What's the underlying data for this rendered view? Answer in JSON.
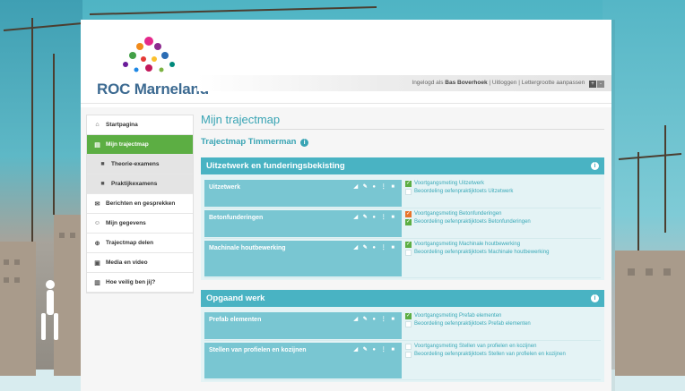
{
  "header": {
    "logo_text": "ROC Marneland",
    "userbar_prefix": "Ingelogd als",
    "user_name": "Bas Boverhoek",
    "logout_label": "Uitloggen",
    "font_size_label": "Lettergrootte aanpassen",
    "separator": "|"
  },
  "sidebar": {
    "items": [
      {
        "label": "Startpagina",
        "icon": "home-icon",
        "glyph": "⌂"
      },
      {
        "label": "Mijn trajectmap",
        "icon": "folder-icon",
        "glyph": "▤"
      },
      {
        "label": "Theorie-examens",
        "icon": "book-icon",
        "glyph": "■"
      },
      {
        "label": "Praktijkexamens",
        "icon": "book-icon",
        "glyph": "■"
      },
      {
        "label": "Berichten en gesprekken",
        "icon": "chat-icon",
        "glyph": "✉"
      },
      {
        "label": "Mijn gegevens",
        "icon": "user-icon",
        "glyph": "☺"
      },
      {
        "label": "Trajectmap delen",
        "icon": "share-icon",
        "glyph": "⊕"
      },
      {
        "label": "Media en video",
        "icon": "image-icon",
        "glyph": "▣"
      },
      {
        "label": "Hoe veilig ben jij?",
        "icon": "document-icon",
        "glyph": "▥"
      }
    ]
  },
  "main": {
    "page_title": "Mijn trajectmap",
    "subtitle": "Trajectmap Timmerman",
    "info_glyph": "i",
    "tool_glyphs": "◢ ✎ ● ⋮ ■",
    "sections": [
      {
        "title": "Uitzetwerk en funderingsbekisting",
        "rows": [
          {
            "title": "Uitzetwerk",
            "links": [
              {
                "text": "Voortgangsmeting Uitzetwerk",
                "status": "green"
              },
              {
                "text": "Beoordeling oefenpraktijktoets Uitzetwerk",
                "status": "empty"
              }
            ]
          },
          {
            "title": "Betonfunderingen",
            "links": [
              {
                "text": "Voortgangsmeting Betonfunderingen",
                "status": "orange"
              },
              {
                "text": "Beoordeling oefenpraktijktoets Betonfunderingen",
                "status": "green"
              }
            ]
          },
          {
            "title": "Machinale houtbewerking",
            "links": [
              {
                "text": "Voortgangsmeting Machinale houtbewerking",
                "status": "green"
              },
              {
                "text": "Beoordeling oefenpraktijktoets Machinale houtbewerking",
                "status": "empty"
              }
            ]
          }
        ]
      },
      {
        "title": "Opgaand werk",
        "rows": [
          {
            "title": "Prefab elementen",
            "links": [
              {
                "text": "Voortgangsmeting Prefab elementen",
                "status": "green"
              },
              {
                "text": "Beoordeling oefenpraktijktoets Prefab elementen",
                "status": "empty"
              }
            ]
          },
          {
            "title": "Stellen van profielen en kozijnen",
            "links": [
              {
                "text": "Voortgangsmeting Stellen van profielen en kozijnen",
                "status": "empty"
              },
              {
                "text": "Beoordeling oefenpraktijktoets Stellen van profielen en kozijnen",
                "status": "empty"
              }
            ]
          }
        ]
      }
    ]
  },
  "colors": {
    "accent": "#49b3c3",
    "active_nav": "#5cae43",
    "status_green": "#5cae43",
    "status_orange": "#e8742a",
    "logo_text": "#3c6a91"
  }
}
